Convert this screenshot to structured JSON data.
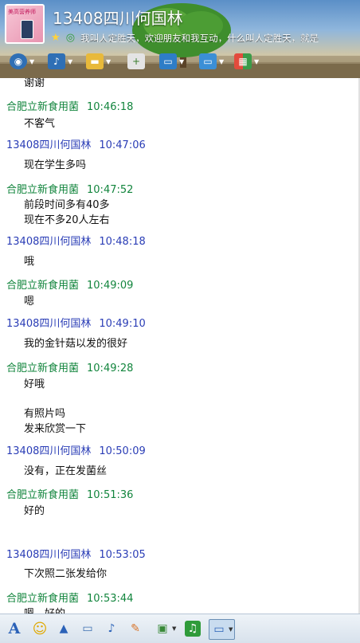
{
  "header": {
    "contact_name": "13408四川何国林",
    "avatar_text": "美高营养师",
    "signature": "我叫人定胜天，欢迎朋友和我互动，什么叫人定胜天，就是"
  },
  "toolbar_top": [
    {
      "icon": "video-camera-icon",
      "has_menu": true
    },
    {
      "icon": "microphone-icon",
      "has_menu": true
    },
    {
      "icon": "folder-icon",
      "has_menu": true
    },
    {
      "icon": "add-contact-icon",
      "has_menu": false
    },
    {
      "icon": "monitor-icon",
      "has_menu": true
    },
    {
      "icon": "share-screen-icon",
      "has_menu": true
    },
    {
      "icon": "apps-grid-icon",
      "has_menu": true
    }
  ],
  "messages": [
    {
      "body": [
        "谢谢"
      ]
    },
    {
      "sender": "合肥立新食用菌",
      "time": "10:46:18",
      "side": "green",
      "body": [
        "不客气"
      ]
    },
    {
      "sender": "13408四川何国林",
      "time": "10:47:06",
      "side": "blue",
      "body": [
        "现在学生多吗"
      ]
    },
    {
      "sender": "合肥立新食用菌",
      "time": "10:47:52",
      "side": "green",
      "body": [
        "前段时间多有40多",
        "现在不多20人左右"
      ]
    },
    {
      "sender": "13408四川何国林",
      "time": "10:48:18",
      "side": "blue",
      "body": [
        "哦"
      ]
    },
    {
      "sender": "合肥立新食用菌",
      "time": "10:49:09",
      "side": "green",
      "body": [
        "嗯"
      ]
    },
    {
      "sender": "13408四川何国林",
      "time": "10:49:10",
      "side": "blue",
      "body": [
        "我的金针菇以发的很好"
      ]
    },
    {
      "sender": "合肥立新食用菌",
      "time": "10:49:28",
      "side": "green",
      "body": [
        "好哦",
        "",
        "有照片吗",
        "发来欣赏一下"
      ]
    },
    {
      "sender": "13408四川何国林",
      "time": "10:50:09",
      "side": "blue",
      "body": [
        "没有，正在发菌丝"
      ]
    },
    {
      "sender": "合肥立新食用菌",
      "time": "10:51:36",
      "side": "green",
      "body": [
        "好的"
      ]
    },
    {
      "sender": "13408四川何国林",
      "time": "10:53:05",
      "side": "blue",
      "body": [
        "下次照二张发给你"
      ]
    },
    {
      "sender": "合肥立新食用菌",
      "time": "10:53:44",
      "side": "green",
      "body": [
        "嗯，好的"
      ]
    }
  ],
  "toolbar_bottom": [
    {
      "icon": "font-icon",
      "label": "A",
      "has_menu": false
    },
    {
      "icon": "emoji-icon",
      "label": "☺",
      "has_menu": false
    },
    {
      "icon": "shake-icon",
      "label": "▲",
      "has_menu": false
    },
    {
      "icon": "video-clip-icon",
      "label": "▭",
      "has_menu": false
    },
    {
      "icon": "voice-message-icon",
      "label": "♪",
      "has_menu": false
    },
    {
      "icon": "scribble-icon",
      "label": "✎",
      "has_menu": false
    },
    {
      "icon": "image-icon",
      "label": "▣",
      "has_menu": true
    },
    {
      "icon": "music-icon",
      "label": "♫",
      "has_menu": false
    },
    {
      "icon": "screenshot-icon",
      "label": "▭",
      "has_menu": true
    }
  ],
  "colors": {
    "green_sender": "#12853d",
    "blue_sender": "#2a3db6"
  }
}
